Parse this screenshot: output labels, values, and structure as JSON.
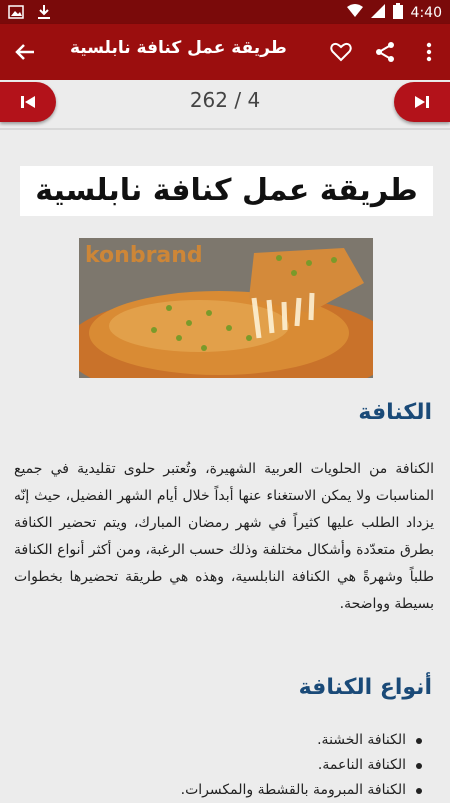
{
  "statusbar": {
    "time": "4:40"
  },
  "appbar": {
    "title": "طريقة عمل كنافة نابلسية"
  },
  "nav": {
    "page_counter": "262 / 4"
  },
  "article": {
    "title": "طريقة عمل كنافة نابلسية",
    "image_watermark": "konbrand",
    "section1": {
      "heading": "الكنافة",
      "paragraph": "الكنافة من الحلويات العربية الشهيرة، وتُعتبر حلوى تقليدية في جميع المناسبات ولا يمكن الاستغناء عنها أبداً خلال أيام الشهر الفضيل، حيث إنّه يزداد الطلب عليها كثيراً في شهر رمضان المبارك، ويتم تحضير الكنافة بطرق متعدّدة وأشكال مختلفة وذلك حسب الرغبة، ومن أكثر أنواع الكنافة طلباً وشهرةً هي الكنافة النابلسية، وهذه هي طريقة تحضيرها بخطوات بسيطة وواضحة."
    },
    "section2": {
      "heading": "أنواع الكنافة",
      "items": [
        "الكنافة الخشنة.",
        "الكنافة الناعمة.",
        "الكنافة المبرومة بالقشطة والمكسرات."
      ]
    }
  },
  "colors": {
    "statusbar": "#7a0a0a",
    "appbar": "#9b0e0e",
    "nav_button": "#b3121a",
    "heading": "#1a4a78"
  }
}
